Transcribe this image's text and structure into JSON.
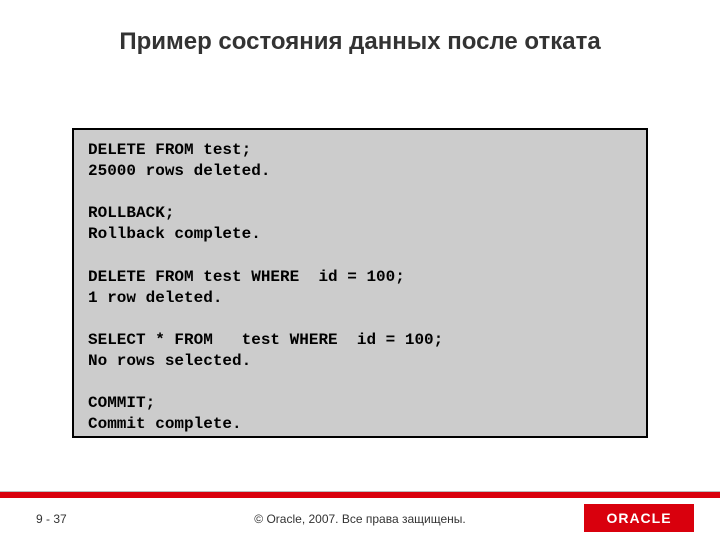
{
  "title": "Пример состояния данных после отката",
  "code": "DELETE FROM test;\n25000 rows deleted.\n\nROLLBACK;\nRollback complete.\n\nDELETE FROM test WHERE  id = 100;\n1 row deleted.\n\nSELECT * FROM   test WHERE  id = 100;\nNo rows selected.\n\nCOMMIT;\nCommit complete.",
  "footer": {
    "page_prefix": "9 - ",
    "page_number": "37",
    "copyright": "© Oracle, 2007. Все права защищены.",
    "logo_text": "ORACLE"
  }
}
